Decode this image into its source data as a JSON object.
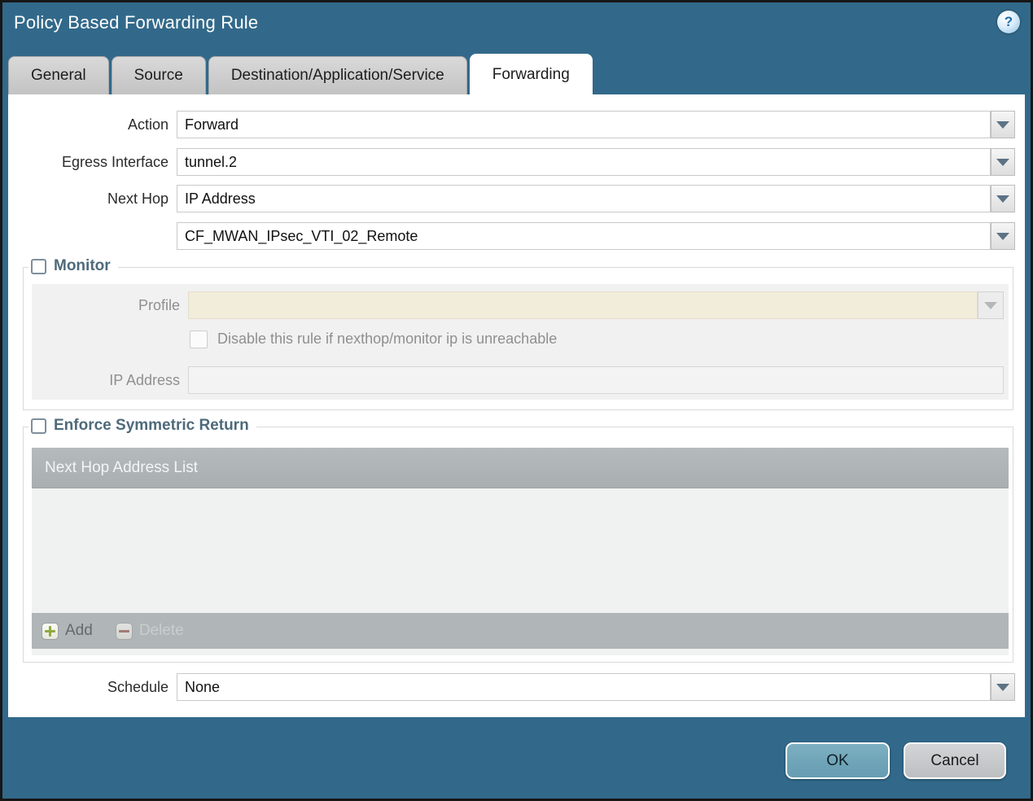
{
  "window": {
    "title": "Policy Based Forwarding Rule",
    "help_glyph": "?"
  },
  "tabs": [
    {
      "label": "General",
      "active": false
    },
    {
      "label": "Source",
      "active": false
    },
    {
      "label": "Destination/Application/Service",
      "active": false
    },
    {
      "label": "Forwarding",
      "active": true
    }
  ],
  "form": {
    "action": {
      "label": "Action",
      "value": "Forward"
    },
    "egress_interface": {
      "label": "Egress Interface",
      "value": "tunnel.2"
    },
    "next_hop": {
      "label": "Next Hop",
      "value": "IP Address"
    },
    "next_hop_address": {
      "value": "CF_MWAN_IPsec_VTI_02_Remote"
    },
    "schedule": {
      "label": "Schedule",
      "value": "None"
    }
  },
  "monitor": {
    "legend": "Monitor",
    "checked": false,
    "profile": {
      "label": "Profile",
      "value": "",
      "disabled": true
    },
    "disable_rule": {
      "label": "Disable this rule if nexthop/monitor ip is unreachable",
      "checked": false,
      "disabled": true
    },
    "ip_address": {
      "label": "IP Address",
      "value": "",
      "disabled": true
    }
  },
  "enforce_symmetric_return": {
    "legend": "Enforce Symmetric Return",
    "checked": false,
    "table": {
      "header": "Next Hop Address List",
      "rows": []
    },
    "actions": {
      "add": "Add",
      "delete": "Delete",
      "delete_disabled": true
    }
  },
  "buttons": {
    "ok": "OK",
    "cancel": "Cancel"
  },
  "colors": {
    "titlebar_teal": "#32698a",
    "active_tab": "#ffffff",
    "inactive_tab": "#c9c9c9",
    "disabled_field_beige": "#f2ecda",
    "table_header_gray": "#aeb3b6",
    "ok_button": "#6fa5b9",
    "cancel_button": "#c7cacc",
    "add_icon_green": "#8faa3e",
    "delete_icon_red": "#9c5a52"
  }
}
